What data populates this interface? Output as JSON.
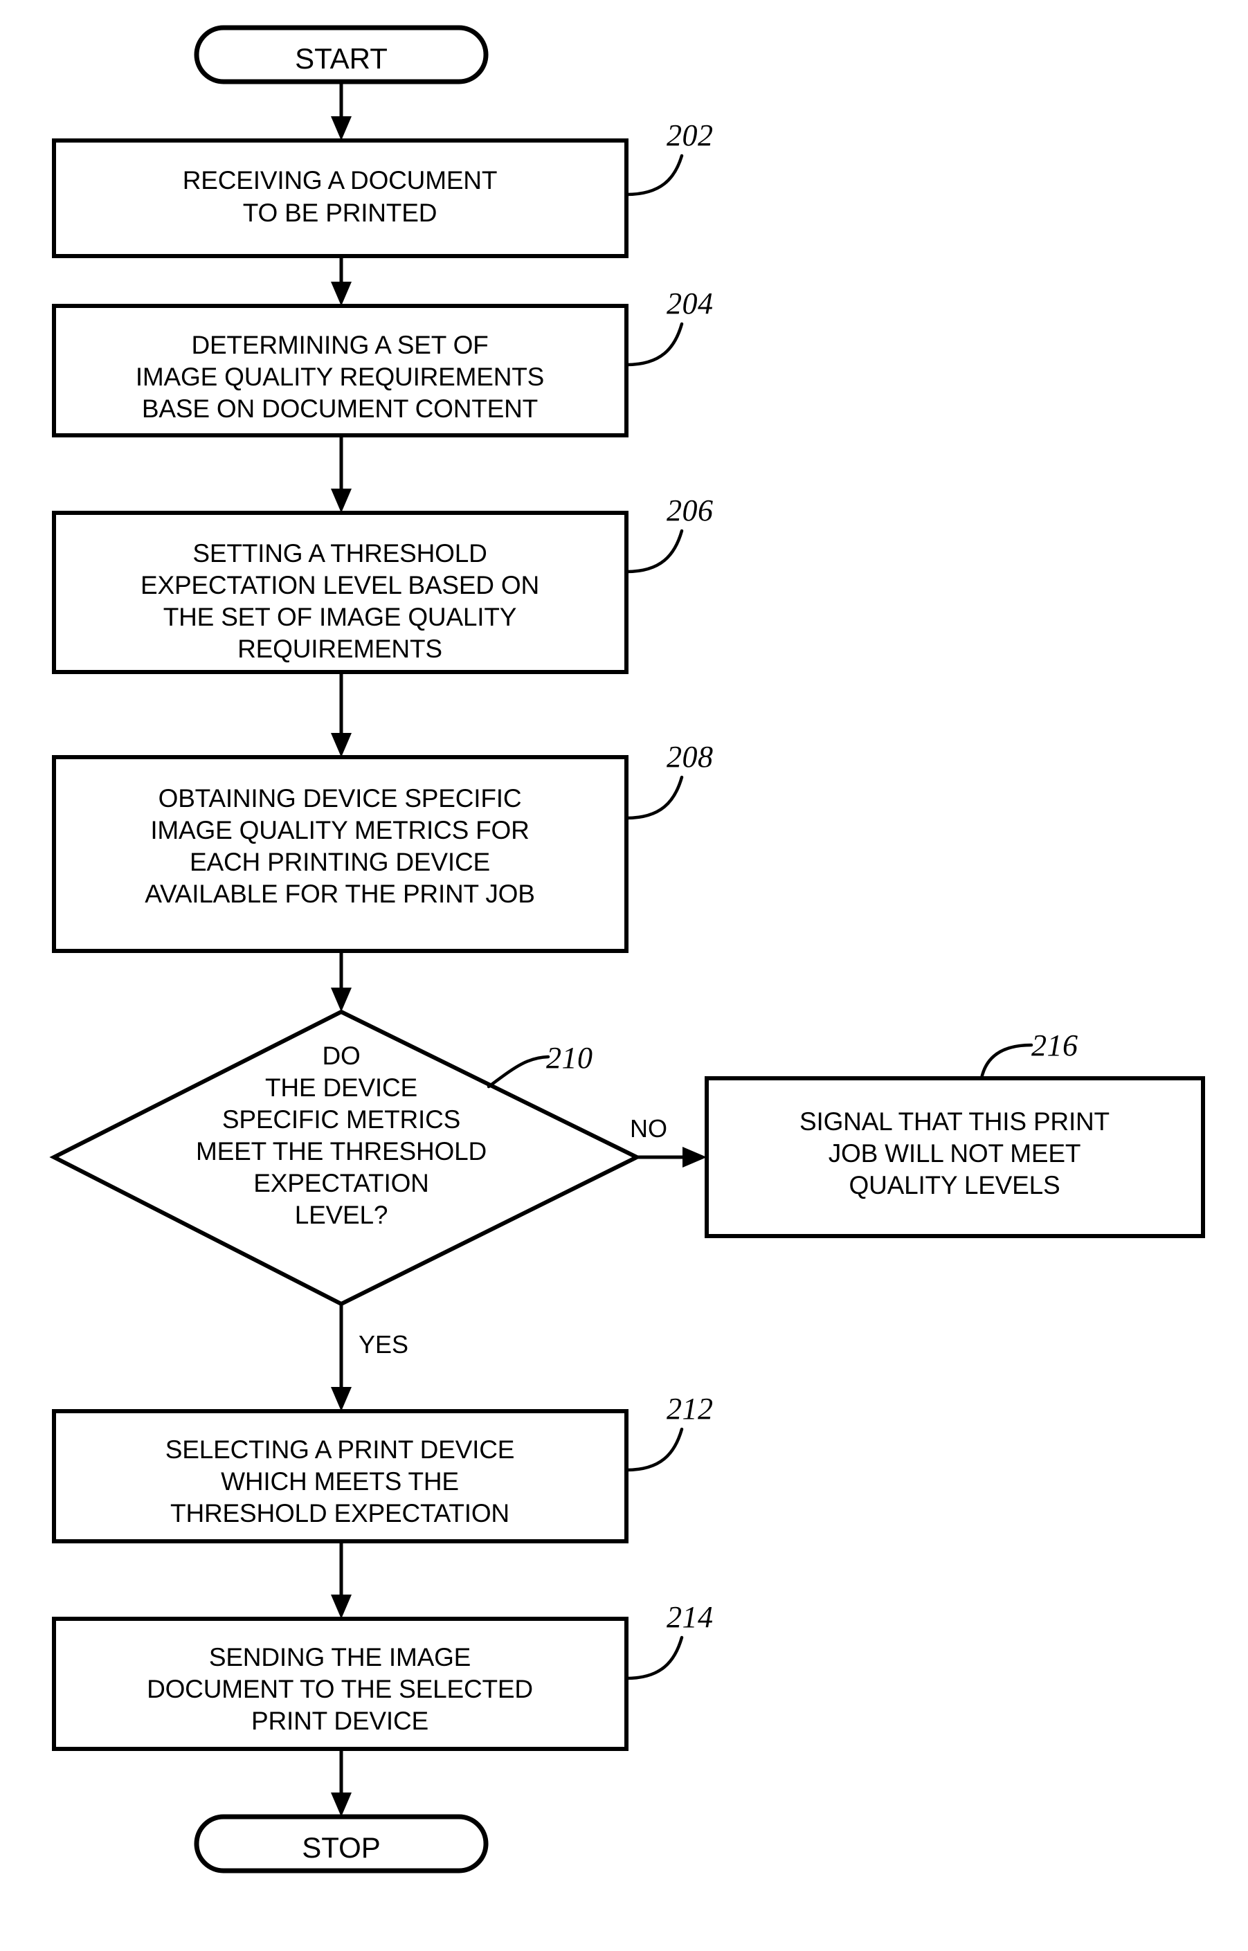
{
  "figure": {
    "type": "process-flowchart",
    "background_color": "#ffffff",
    "line_color": "#000000"
  },
  "nodes": {
    "start": {
      "kind": "terminator",
      "label": "START"
    },
    "step_202": {
      "kind": "process",
      "ref": "202",
      "lines": [
        "RECEIVING A DOCUMENT",
        "TO BE PRINTED"
      ]
    },
    "step_204": {
      "kind": "process",
      "ref": "204",
      "lines": [
        "DETERMINING A SET OF",
        "IMAGE QUALITY REQUIREMENTS",
        "BASE ON DOCUMENT CONTENT"
      ]
    },
    "step_206": {
      "kind": "process",
      "ref": "206",
      "lines": [
        "SETTING A THRESHOLD",
        "EXPECTATION LEVEL BASED ON",
        "THE SET OF IMAGE QUALITY",
        "REQUIREMENTS"
      ]
    },
    "step_208": {
      "kind": "process",
      "ref": "208",
      "lines": [
        "OBTAINING DEVICE SPECIFIC",
        "IMAGE QUALITY METRICS FOR",
        "EACH PRINTING DEVICE",
        "AVAILABLE FOR THE PRINT JOB"
      ]
    },
    "decision_210": {
      "kind": "decision",
      "ref": "210",
      "lines": [
        "DO",
        "THE DEVICE",
        "SPECIFIC METRICS",
        "MEET THE THRESHOLD",
        "EXPECTATION",
        "LEVEL?"
      ]
    },
    "step_216": {
      "kind": "process",
      "ref": "216",
      "lines": [
        "SIGNAL THAT THIS PRINT",
        "JOB WILL NOT MEET",
        "QUALITY LEVELS"
      ]
    },
    "step_212": {
      "kind": "process",
      "ref": "212",
      "lines": [
        "SELECTING A PRINT DEVICE",
        "WHICH MEETS THE",
        "THRESHOLD EXPECTATION"
      ]
    },
    "step_214": {
      "kind": "process",
      "ref": "214",
      "lines": [
        "SENDING THE IMAGE",
        "DOCUMENT TO THE SELECTED",
        "PRINT DEVICE"
      ]
    },
    "stop": {
      "kind": "terminator",
      "label": "STOP"
    }
  },
  "branch_labels": {
    "no": "NO",
    "yes": "YES"
  }
}
